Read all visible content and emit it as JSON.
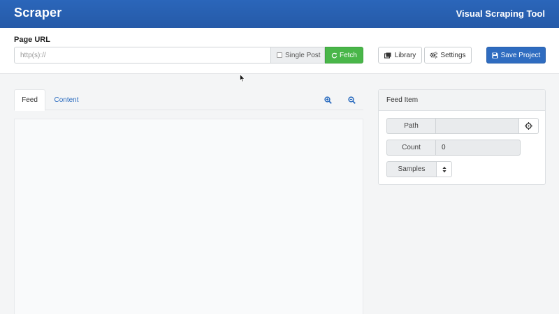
{
  "header": {
    "brand": "Scraper",
    "app_title": "Visual Scraping Tool",
    "bg_color": "#2b66ba"
  },
  "toolbar": {
    "url_label": "Page URL",
    "url_placeholder": "http(s)://",
    "url_value": "",
    "single_post_label": "Single Post",
    "single_post_checked": false,
    "fetch_label": "Fetch",
    "fetch_icon": "refresh-icon",
    "library_label": "Library",
    "library_icon": "library-icon",
    "settings_label": "Settings",
    "settings_icon": "gears-icon",
    "save_label": "Save Project",
    "save_icon": "floppy-disk-icon",
    "fetch_color": "#49b649",
    "save_color": "#2f6cc0"
  },
  "tabs": {
    "items": [
      {
        "label": "Feed",
        "active": true
      },
      {
        "label": "Content",
        "active": false
      }
    ],
    "zoom_in_icon": "zoom-in-icon",
    "zoom_out_icon": "zoom-out-icon"
  },
  "feed_item": {
    "title": "Feed Item",
    "path_label": "Path",
    "path_value": "",
    "path_button_icon": "crosshair-icon",
    "count_label": "Count",
    "count_value": "0",
    "samples_label": "Samples",
    "samples_value": ""
  }
}
